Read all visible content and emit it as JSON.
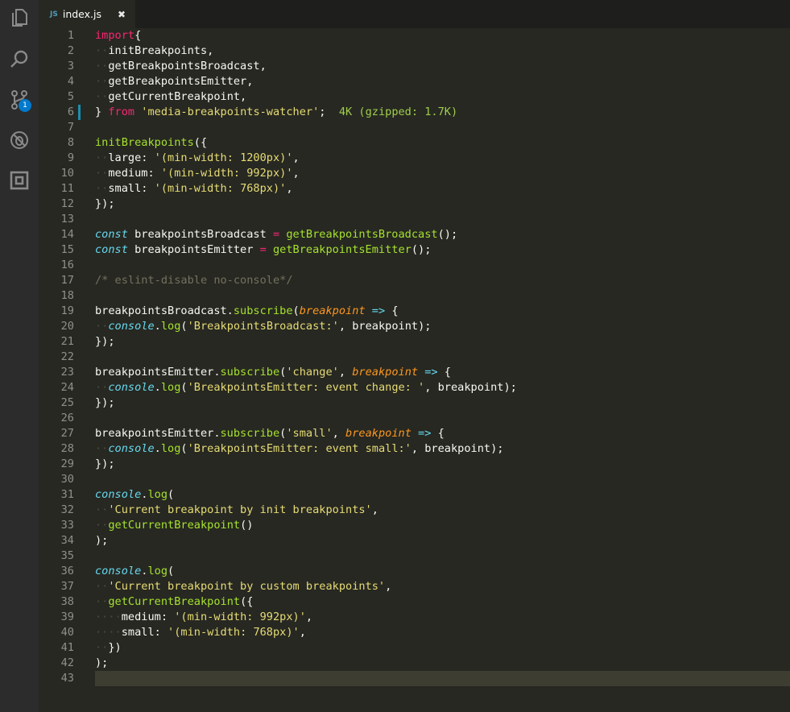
{
  "activity_bar": {
    "icons": [
      "files-icon",
      "search-icon",
      "source-control-icon",
      "debug-icon",
      "extensions-icon"
    ],
    "scm_badge": "1"
  },
  "tabs": [
    {
      "lang": "JS",
      "label": "index.js",
      "close": "✖"
    }
  ],
  "colors": {
    "background": "#272822",
    "keyword": "#f92672",
    "function": "#a6e22e",
    "string": "#e6db74",
    "storage": "#66d9ef",
    "parameter": "#fd971f",
    "comment": "#75715e",
    "import_cost": "#9fce4a"
  },
  "editor": {
    "import_cost": "4K (gzipped: 1.7K)",
    "lines": [
      {
        "n": "1",
        "t": [
          [
            "kw",
            "import"
          ],
          [
            "",
            "{"
          ]
        ]
      },
      {
        "n": "2",
        "t": [
          [
            "ws",
            "··"
          ],
          [
            "",
            "initBreakpoints,"
          ]
        ]
      },
      {
        "n": "3",
        "t": [
          [
            "ws",
            "··"
          ],
          [
            "",
            "getBreakpointsBroadcast,"
          ]
        ]
      },
      {
        "n": "4",
        "t": [
          [
            "ws",
            "··"
          ],
          [
            "",
            "getBreakpointsEmitter,"
          ]
        ]
      },
      {
        "n": "5",
        "t": [
          [
            "ws",
            "··"
          ],
          [
            "",
            "getCurrentBreakpoint,"
          ]
        ]
      },
      {
        "n": "6",
        "t": [
          [
            "",
            "} "
          ],
          [
            "kw",
            "from"
          ],
          [
            "str",
            " 'media-breakpoints-watcher'"
          ],
          [
            "",
            ";  "
          ],
          [
            "sz",
            "4K (gzipped: 1.7K)"
          ]
        ]
      },
      {
        "n": "7",
        "t": []
      },
      {
        "n": "8",
        "t": [
          [
            "fn",
            "initBreakpoints"
          ],
          [
            "",
            "({"
          ]
        ]
      },
      {
        "n": "9",
        "t": [
          [
            "ws",
            "··"
          ],
          [
            "",
            "large: "
          ],
          [
            "str",
            "'(min-width: 1200px)'"
          ],
          [
            "",
            ","
          ]
        ]
      },
      {
        "n": "10",
        "t": [
          [
            "ws",
            "··"
          ],
          [
            "",
            "medium: "
          ],
          [
            "str",
            "'(min-width: 992px)'"
          ],
          [
            "",
            ","
          ]
        ]
      },
      {
        "n": "11",
        "t": [
          [
            "ws",
            "··"
          ],
          [
            "",
            "small: "
          ],
          [
            "str",
            "'(min-width: 768px)'"
          ],
          [
            "",
            ","
          ]
        ]
      },
      {
        "n": "12",
        "t": [
          [
            "",
            "});"
          ]
        ]
      },
      {
        "n": "13",
        "t": []
      },
      {
        "n": "14",
        "t": [
          [
            "sto",
            "const"
          ],
          [
            "",
            " breakpointsBroadcast "
          ],
          [
            "op",
            "="
          ],
          [
            "fn",
            " getBreakpointsBroadcast"
          ],
          [
            "",
            "();"
          ]
        ]
      },
      {
        "n": "15",
        "t": [
          [
            "sto",
            "const"
          ],
          [
            "",
            " breakpointsEmitter "
          ],
          [
            "op",
            "="
          ],
          [
            "fn",
            " getBreakpointsEmitter"
          ],
          [
            "",
            "();"
          ]
        ]
      },
      {
        "n": "16",
        "t": []
      },
      {
        "n": "17",
        "t": [
          [
            "cmt",
            "/* eslint-disable no-console*/"
          ]
        ]
      },
      {
        "n": "18",
        "t": []
      },
      {
        "n": "19",
        "t": [
          [
            "",
            "breakpointsBroadcast."
          ],
          [
            "fn",
            "subscribe"
          ],
          [
            "",
            "("
          ],
          [
            "prm",
            "breakpoint"
          ],
          [
            "arr",
            " =>"
          ],
          [
            "",
            " {"
          ]
        ]
      },
      {
        "n": "20",
        "t": [
          [
            "ws",
            "··"
          ],
          [
            "sto",
            "console"
          ],
          [
            "",
            "."
          ],
          [
            "fn",
            "log"
          ],
          [
            "",
            "("
          ],
          [
            "str",
            "'BreakpointsBroadcast:'"
          ],
          [
            "",
            ", breakpoint);"
          ]
        ]
      },
      {
        "n": "21",
        "t": [
          [
            "",
            "});"
          ]
        ]
      },
      {
        "n": "22",
        "t": []
      },
      {
        "n": "23",
        "t": [
          [
            "",
            "breakpointsEmitter."
          ],
          [
            "fn",
            "subscribe"
          ],
          [
            "",
            "("
          ],
          [
            "str",
            "'change'"
          ],
          [
            "",
            ", "
          ],
          [
            "prm",
            "breakpoint"
          ],
          [
            "arr",
            " =>"
          ],
          [
            "",
            " {"
          ]
        ]
      },
      {
        "n": "24",
        "t": [
          [
            "ws",
            "··"
          ],
          [
            "sto",
            "console"
          ],
          [
            "",
            "."
          ],
          [
            "fn",
            "log"
          ],
          [
            "",
            "("
          ],
          [
            "str",
            "'BreakpointsEmitter: event change: '"
          ],
          [
            "",
            ", breakpoint);"
          ]
        ]
      },
      {
        "n": "25",
        "t": [
          [
            "",
            "});"
          ]
        ]
      },
      {
        "n": "26",
        "t": []
      },
      {
        "n": "27",
        "t": [
          [
            "",
            "breakpointsEmitter."
          ],
          [
            "fn",
            "subscribe"
          ],
          [
            "",
            "("
          ],
          [
            "str",
            "'small'"
          ],
          [
            "",
            ", "
          ],
          [
            "prm",
            "breakpoint"
          ],
          [
            "arr",
            " =>"
          ],
          [
            "",
            " {"
          ]
        ]
      },
      {
        "n": "28",
        "t": [
          [
            "ws",
            "··"
          ],
          [
            "sto",
            "console"
          ],
          [
            "",
            "."
          ],
          [
            "fn",
            "log"
          ],
          [
            "",
            "("
          ],
          [
            "str",
            "'BreakpointsEmitter: event small:'"
          ],
          [
            "",
            ", breakpoint);"
          ]
        ]
      },
      {
        "n": "29",
        "t": [
          [
            "",
            "});"
          ]
        ]
      },
      {
        "n": "30",
        "t": []
      },
      {
        "n": "31",
        "t": [
          [
            "sto",
            "console"
          ],
          [
            "",
            "."
          ],
          [
            "fn",
            "log"
          ],
          [
            "",
            "("
          ]
        ]
      },
      {
        "n": "32",
        "t": [
          [
            "ws",
            "··"
          ],
          [
            "str",
            "'Current breakpoint by init breakpoints'"
          ],
          [
            "",
            ","
          ]
        ]
      },
      {
        "n": "33",
        "t": [
          [
            "ws",
            "··"
          ],
          [
            "fn",
            "getCurrentBreakpoint"
          ],
          [
            "",
            "()"
          ]
        ]
      },
      {
        "n": "34",
        "t": [
          [
            "",
            ");"
          ]
        ]
      },
      {
        "n": "35",
        "t": []
      },
      {
        "n": "36",
        "t": [
          [
            "sto",
            "console"
          ],
          [
            "",
            "."
          ],
          [
            "fn",
            "log"
          ],
          [
            "",
            "("
          ]
        ]
      },
      {
        "n": "37",
        "t": [
          [
            "ws",
            "··"
          ],
          [
            "str",
            "'Current breakpoint by custom breakpoints'"
          ],
          [
            "",
            ","
          ]
        ]
      },
      {
        "n": "38",
        "t": [
          [
            "ws",
            "··"
          ],
          [
            "fn",
            "getCurrentBreakpoint"
          ],
          [
            "",
            "({"
          ]
        ]
      },
      {
        "n": "39",
        "t": [
          [
            "ws",
            "····"
          ],
          [
            "",
            "medium: "
          ],
          [
            "str",
            "'(min-width: 992px)'"
          ],
          [
            "",
            ","
          ]
        ]
      },
      {
        "n": "40",
        "t": [
          [
            "ws",
            "····"
          ],
          [
            "",
            "small: "
          ],
          [
            "str",
            "'(min-width: 768px)'"
          ],
          [
            "",
            ","
          ]
        ]
      },
      {
        "n": "41",
        "t": [
          [
            "ws",
            "··"
          ],
          [
            "",
            "})"
          ]
        ]
      },
      {
        "n": "42",
        "t": [
          [
            "",
            ");"
          ]
        ]
      },
      {
        "n": "43",
        "t": []
      }
    ]
  }
}
